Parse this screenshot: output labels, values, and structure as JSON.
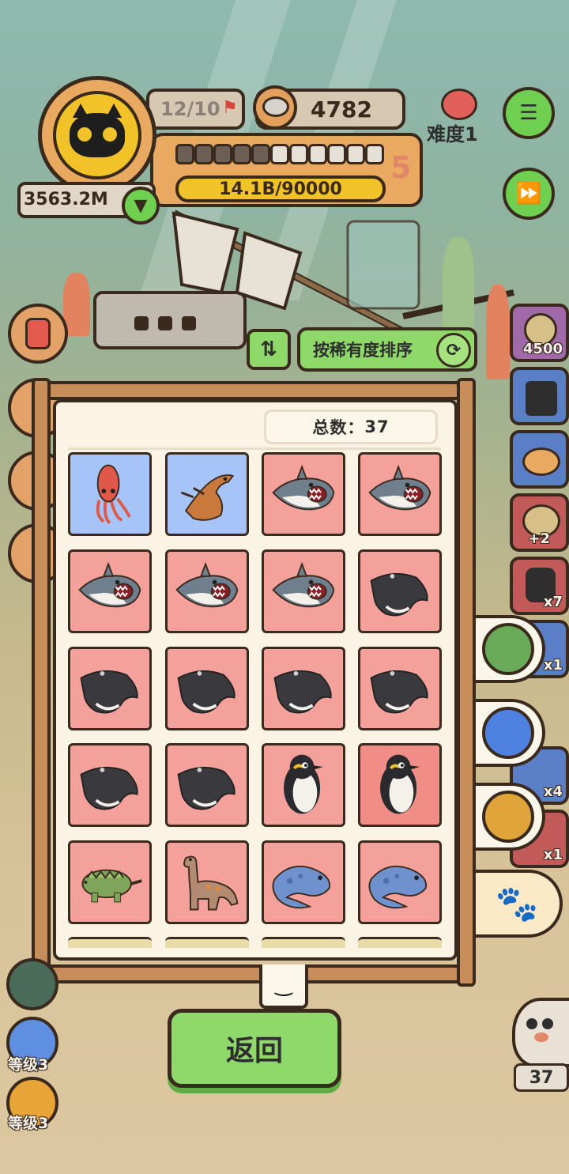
{
  "hud": {
    "stage": "12/10",
    "coins": "4782",
    "level_number": "5",
    "progress_text": "14.1B/90000",
    "money": "3563.2M",
    "difficulty": "难度1",
    "progress_segments_filled": 5,
    "progress_segments_total": 11
  },
  "side_items": [
    {
      "name": "item-4500",
      "label": "4500"
    },
    {
      "name": "item-shirt",
      "label": ""
    },
    {
      "name": "item-bowl",
      "label": ""
    },
    {
      "name": "item-plus2",
      "label": "+2"
    },
    {
      "name": "item-bag",
      "label": "x7"
    },
    {
      "name": "item-x1-a",
      "label": "x1"
    },
    {
      "name": "item-can",
      "label": "x4"
    },
    {
      "name": "item-x1-b",
      "label": "x1"
    }
  ],
  "sort": {
    "label": "按稀有度排序"
  },
  "collection": {
    "total_label": "总数：",
    "total_value": "37",
    "cards": [
      {
        "creature": "squid",
        "rarity": "blue"
      },
      {
        "creature": "dino-orange",
        "rarity": "blue"
      },
      {
        "creature": "shark",
        "rarity": "red"
      },
      {
        "creature": "shark",
        "rarity": "red"
      },
      {
        "creature": "shark",
        "rarity": "red"
      },
      {
        "creature": "shark",
        "rarity": "red"
      },
      {
        "creature": "shark",
        "rarity": "red"
      },
      {
        "creature": "manta",
        "rarity": "red"
      },
      {
        "creature": "manta",
        "rarity": "red"
      },
      {
        "creature": "manta",
        "rarity": "red"
      },
      {
        "creature": "manta",
        "rarity": "red"
      },
      {
        "creature": "manta",
        "rarity": "red"
      },
      {
        "creature": "manta",
        "rarity": "red"
      },
      {
        "creature": "manta",
        "rarity": "red"
      },
      {
        "creature": "penguin",
        "rarity": "red"
      },
      {
        "creature": "penguin",
        "rarity": "red-dark"
      },
      {
        "creature": "ankylosaurus",
        "rarity": "red"
      },
      {
        "creature": "sauropod",
        "rarity": "red"
      },
      {
        "creature": "plesiosaur",
        "rarity": "red"
      },
      {
        "creature": "plesiosaur",
        "rarity": "red"
      }
    ]
  },
  "left_badges": [
    {
      "label": "等级3",
      "color": "#5f8fe0"
    },
    {
      "label": "等级3",
      "color": "#e8a437"
    }
  ],
  "pet_count": "37",
  "back_label": "返回",
  "colors": {
    "card_blue": "#a6c4f7",
    "card_red": "#f3a19a",
    "button_green": "#8fd86a",
    "outline": "#3a2a1e"
  }
}
